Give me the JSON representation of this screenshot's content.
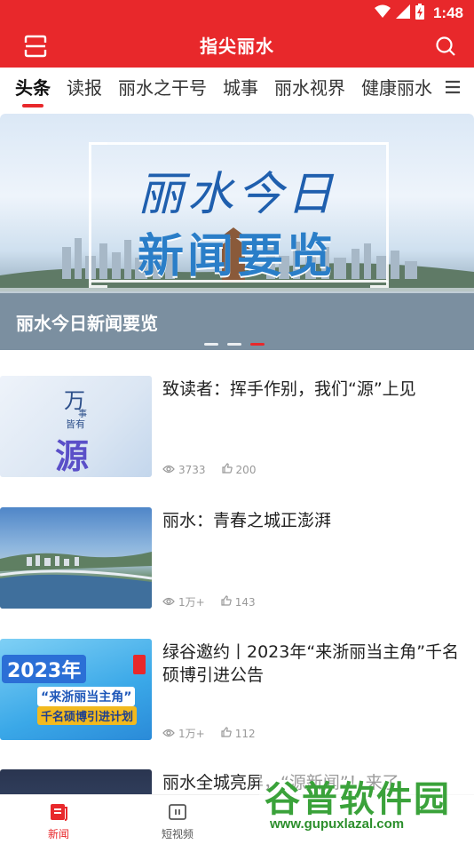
{
  "status_bar": {
    "time": "1:48"
  },
  "header": {
    "title": "指尖丽水"
  },
  "tabs": [
    {
      "label": "头条"
    },
    {
      "label": "读报"
    },
    {
      "label": "丽水之干号"
    },
    {
      "label": "城事"
    },
    {
      "label": "丽水视界"
    },
    {
      "label": "健康丽水"
    }
  ],
  "banner": {
    "line1": "丽水今日",
    "line2": "新闻要览",
    "caption": "丽水今日新闻要览",
    "slide_count": 3,
    "active_slide": 3
  },
  "news": [
    {
      "title": "致读者：挥手作别，我们“源”上见",
      "views": "3733",
      "likes": "200",
      "thumb": {
        "chars": [
          "万",
          "事",
          "皆有",
          "源"
        ]
      }
    },
    {
      "title": "丽水：青春之城正澎湃",
      "views": "1万+",
      "likes": "143"
    },
    {
      "title": "绿谷邀约丨2023年“来浙丽当主角”千名硕博引进公告",
      "views": "1万+",
      "likes": "112",
      "thumb": {
        "year": "2023年",
        "line1": "“来浙丽当主角”",
        "line2": "千名硕博引进计划"
      }
    },
    {
      "title": "丽水全城亮屏，“源新闻”！来了"
    }
  ],
  "bottom_nav": [
    {
      "label": "新闻",
      "active": true
    },
    {
      "label": "短视频",
      "active": false
    }
  ],
  "watermark": {
    "title": "谷普软件园",
    "url": "www.gupuxlazal.com"
  },
  "colors": {
    "brand": "#e8282b",
    "meta": "#999999"
  }
}
